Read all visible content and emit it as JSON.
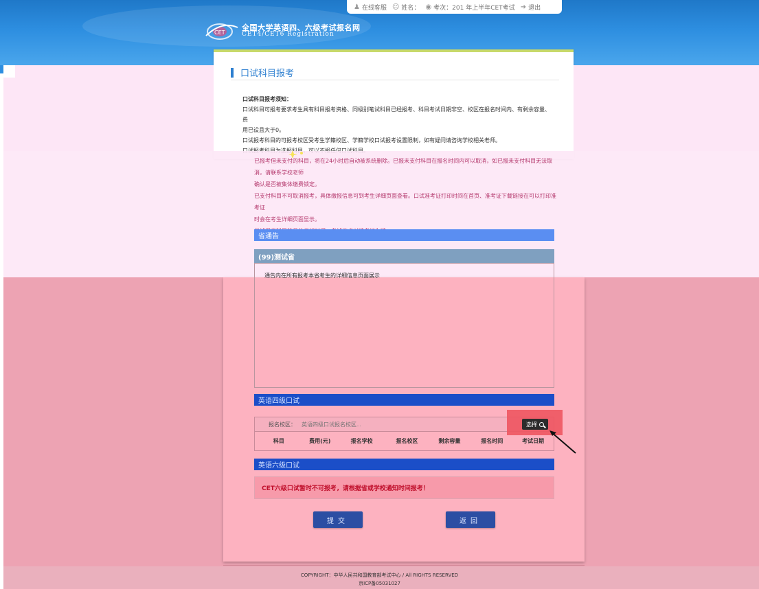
{
  "topbar": {
    "service": "在线客服",
    "name_label": "姓名：",
    "exam_label": "考次：201  年上半年CET考试",
    "logout": "退出"
  },
  "logo": {
    "cn": "全国大学英语四、六级考试报名网",
    "en": "CET4/CET6  Registration"
  },
  "page": {
    "title": "口试科目报考"
  },
  "notice": {
    "heading": "口试科目报考须知：",
    "lines": [
      "口试科目可报考要求考生具有科目报考资格、同级别笔试科目已经报考、科目考试日期非空、校区在报名时间内、有剩余容量、费",
      "用已设且大于0。",
      "口试报考科目的可报考校区受考生学籍校区、学籍学校口试报考设置限制，如有疑问请咨询学校相关老师。",
      "口试报考科目为选报科目，可以不报任何口试科目。"
    ],
    "pink_lines": [
      "已报考但未支付的科目，将在24小时后自动被系统删除。已报未支付科目在报名时间内可以取消，如已报未支付科目无法取消，请联系学校老师",
      "确认是否被集体缴费锁定。",
      "已支付科目不可取消报考，具体缴报信息可到考生详细页面查看。口试准考证打印时间在首页、准考证下载链接在可以打印准考证",
      "时会在考生详细页面显示。",
      "口试报考科目的具体考试时间、考试地点以准考证为准。"
    ]
  },
  "announcement": {
    "header": "省通告",
    "province": "(99)测试省",
    "body": "通告内在所有报考本省考生的详细信息页面展示"
  },
  "cet4": {
    "header": "英语四级口试",
    "campus_label": "报名校区：",
    "campus_placeholder": "英语四级口试报名校区...",
    "choose_button": "选择",
    "columns": [
      "科目",
      "费用(元)",
      "报名学校",
      "报名校区",
      "剩余容量",
      "报名时间",
      "考试日期"
    ]
  },
  "cet6": {
    "header": "英语六级口试",
    "warning": "CET六级口试暂时不可报考，请根据省或学校通知时间报考！"
  },
  "actions": {
    "submit": "提交",
    "back": "返回"
  },
  "footer": {
    "copyright": "COPYRIGHT：中华人民共和国教育部考试中心 / All RIGHTS RESERVED",
    "icp": "京ICP备05031027"
  },
  "colors": {
    "header_blue": "#2d8ee0",
    "section_blue": "#1b4ec8",
    "announce_blue": "#5a8ef2",
    "warning_red": "#c0102c",
    "highlight": "#ee5560"
  }
}
